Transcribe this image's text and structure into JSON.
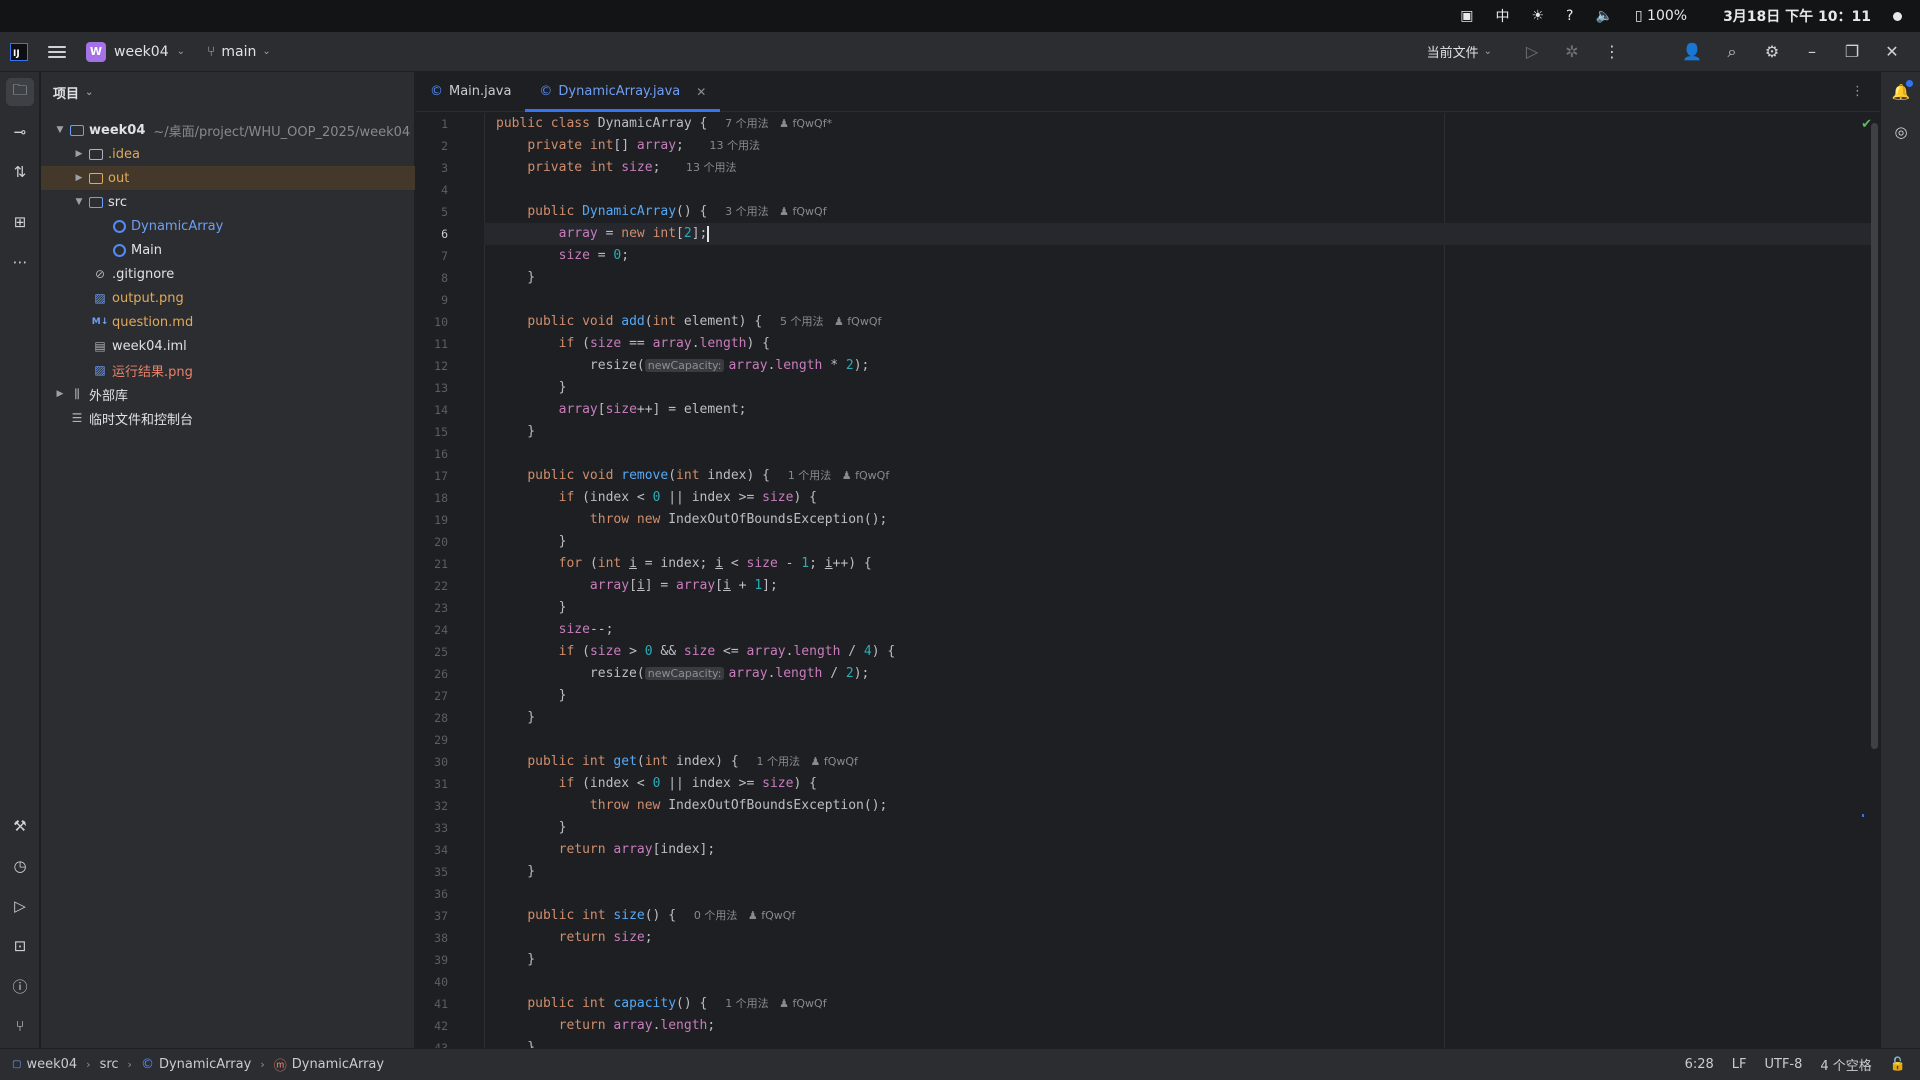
{
  "system_bar": {
    "input_method": "中",
    "battery": "100%",
    "clock": "3月18日 下午 10：11"
  },
  "title_bar": {
    "project_initial": "W",
    "project_name": "week04",
    "branch": "main",
    "run_config": "当前文件"
  },
  "project_panel": {
    "title": "项目",
    "tree": [
      {
        "name": "week04",
        "detail": "~/桌面/project/WHU_OOP_2025/week04",
        "depth": 0,
        "expanded": true,
        "kind": "module"
      },
      {
        "name": ".idea",
        "depth": 1,
        "expanded": false,
        "kind": "folder"
      },
      {
        "name": "out",
        "depth": 1,
        "expanded": false,
        "kind": "folder",
        "selected": true
      },
      {
        "name": "src",
        "depth": 1,
        "expanded": true,
        "kind": "folder"
      },
      {
        "name": "DynamicArray",
        "depth": 2,
        "kind": "class"
      },
      {
        "name": "Main",
        "depth": 2,
        "kind": "class-main"
      },
      {
        "name": ".gitignore",
        "depth": 1,
        "kind": "ignore"
      },
      {
        "name": "output.png",
        "depth": 1,
        "kind": "image"
      },
      {
        "name": "question.md",
        "depth": 1,
        "kind": "markdown"
      },
      {
        "name": "week04.iml",
        "depth": 1,
        "kind": "iml"
      },
      {
        "name": "运行结果.png",
        "depth": 1,
        "kind": "image"
      },
      {
        "name": "外部库",
        "depth": 0,
        "expanded": false,
        "kind": "library"
      },
      {
        "name": "临时文件和控制台",
        "depth": 0,
        "kind": "scratch"
      }
    ]
  },
  "editor": {
    "tabs": [
      {
        "label": "Main.java",
        "active": false
      },
      {
        "label": "DynamicArray.java",
        "active": true
      }
    ],
    "current_line": 6,
    "lines": [
      [
        [
          "kw",
          "public "
        ],
        [
          "kw",
          "class "
        ],
        [
          "t",
          "DynamicArray { "
        ],
        [
          "h",
          "7 个用法   ♟ fQwQf*"
        ]
      ],
      [
        [
          "t",
          "    "
        ],
        [
          "kw",
          "private "
        ],
        [
          "kw",
          "int"
        ],
        [
          "t",
          "[] "
        ],
        [
          "fld",
          "array"
        ],
        [
          "t",
          ";  "
        ],
        [
          "h",
          "13 个用法"
        ]
      ],
      [
        [
          "t",
          "    "
        ],
        [
          "kw",
          "private "
        ],
        [
          "kw",
          "int "
        ],
        [
          "fld",
          "size"
        ],
        [
          "t",
          ";  "
        ],
        [
          "h",
          "13 个用法"
        ]
      ],
      [],
      [
        [
          "t",
          "    "
        ],
        [
          "kw",
          "public "
        ],
        [
          "fn",
          "DynamicArray"
        ],
        [
          "t",
          "() { "
        ],
        [
          "h",
          "3 个用法   ♟ fQwQf"
        ]
      ],
      [
        [
          "t",
          "        "
        ],
        [
          "fld",
          "array"
        ],
        [
          "t",
          " = "
        ],
        [
          "kw",
          "new "
        ],
        [
          "kw",
          "int"
        ],
        [
          "t",
          "["
        ],
        [
          "num",
          "2"
        ],
        [
          "t",
          "];"
        ],
        [
          "caret",
          ""
        ]
      ],
      [
        [
          "t",
          "        "
        ],
        [
          "fld",
          "size"
        ],
        [
          "t",
          " = "
        ],
        [
          "num",
          "0"
        ],
        [
          "t",
          ";"
        ]
      ],
      [
        [
          "t",
          "    }"
        ]
      ],
      [],
      [
        [
          "t",
          "    "
        ],
        [
          "kw",
          "public "
        ],
        [
          "kw",
          "void "
        ],
        [
          "fn",
          "add"
        ],
        [
          "t",
          "("
        ],
        [
          "kw",
          "int "
        ],
        [
          "t",
          "element) { "
        ],
        [
          "h",
          "5 个用法   ♟ fQwQf"
        ]
      ],
      [
        [
          "t",
          "        "
        ],
        [
          "kw",
          "if "
        ],
        [
          "t",
          "("
        ],
        [
          "fld",
          "size"
        ],
        [
          "t",
          " == "
        ],
        [
          "fld",
          "array"
        ],
        [
          "t",
          "."
        ],
        [
          "fld",
          "length"
        ],
        [
          "t",
          ") {"
        ]
      ],
      [
        [
          "t",
          "            resize("
        ],
        [
          "inlay",
          "newCapacity:"
        ],
        [
          "fld",
          "array"
        ],
        [
          "t",
          "."
        ],
        [
          "fld",
          "length"
        ],
        [
          "t",
          " * "
        ],
        [
          "num",
          "2"
        ],
        [
          "t",
          ");"
        ]
      ],
      [
        [
          "t",
          "        }"
        ]
      ],
      [
        [
          "t",
          "        "
        ],
        [
          "fld",
          "array"
        ],
        [
          "t",
          "["
        ],
        [
          "fld",
          "size"
        ],
        [
          "t",
          "++] = element;"
        ]
      ],
      [
        [
          "t",
          "    }"
        ]
      ],
      [],
      [
        [
          "t",
          "    "
        ],
        [
          "kw",
          "public "
        ],
        [
          "kw",
          "void "
        ],
        [
          "fn",
          "remove"
        ],
        [
          "t",
          "("
        ],
        [
          "kw",
          "int "
        ],
        [
          "t",
          "index) { "
        ],
        [
          "h",
          "1 个用法   ♟ fQwQf"
        ]
      ],
      [
        [
          "t",
          "        "
        ],
        [
          "kw",
          "if "
        ],
        [
          "t",
          "(index < "
        ],
        [
          "num",
          "0"
        ],
        [
          "t",
          " || index >= "
        ],
        [
          "fld",
          "size"
        ],
        [
          "t",
          ") {"
        ]
      ],
      [
        [
          "t",
          "            "
        ],
        [
          "kw",
          "throw "
        ],
        [
          "kw",
          "new "
        ],
        [
          "t",
          "IndexOutOfBoundsException();"
        ]
      ],
      [
        [
          "t",
          "        }"
        ]
      ],
      [
        [
          "t",
          "        "
        ],
        [
          "kw",
          "for "
        ],
        [
          "t",
          "("
        ],
        [
          "kw",
          "int "
        ],
        [
          "u",
          "i"
        ],
        [
          "t",
          " = index; "
        ],
        [
          "u",
          "i"
        ],
        [
          "t",
          " < "
        ],
        [
          "fld",
          "size"
        ],
        [
          "t",
          " - "
        ],
        [
          "num",
          "1"
        ],
        [
          "t",
          "; "
        ],
        [
          "u",
          "i"
        ],
        [
          "t",
          "++) {"
        ]
      ],
      [
        [
          "t",
          "            "
        ],
        [
          "fld",
          "array"
        ],
        [
          "t",
          "["
        ],
        [
          "u",
          "i"
        ],
        [
          "t",
          "] = "
        ],
        [
          "fld",
          "array"
        ],
        [
          "t",
          "["
        ],
        [
          "u",
          "i"
        ],
        [
          "t",
          " + "
        ],
        [
          "num",
          "1"
        ],
        [
          "t",
          "];"
        ]
      ],
      [
        [
          "t",
          "        }"
        ]
      ],
      [
        [
          "t",
          "        "
        ],
        [
          "fld",
          "size"
        ],
        [
          "t",
          "--;"
        ]
      ],
      [
        [
          "t",
          "        "
        ],
        [
          "kw",
          "if "
        ],
        [
          "t",
          "("
        ],
        [
          "fld",
          "size"
        ],
        [
          "t",
          " > "
        ],
        [
          "num",
          "0"
        ],
        [
          "t",
          " && "
        ],
        [
          "fld",
          "size"
        ],
        [
          "t",
          " <= "
        ],
        [
          "fld",
          "array"
        ],
        [
          "t",
          "."
        ],
        [
          "fld",
          "length"
        ],
        [
          "t",
          " / "
        ],
        [
          "num",
          "4"
        ],
        [
          "t",
          ") {"
        ]
      ],
      [
        [
          "t",
          "            resize("
        ],
        [
          "inlay",
          "newCapacity:"
        ],
        [
          "fld",
          "array"
        ],
        [
          "t",
          "."
        ],
        [
          "fld",
          "length"
        ],
        [
          "t",
          " / "
        ],
        [
          "num",
          "2"
        ],
        [
          "t",
          ");"
        ]
      ],
      [
        [
          "t",
          "        }"
        ]
      ],
      [
        [
          "t",
          "    }"
        ]
      ],
      [],
      [
        [
          "t",
          "    "
        ],
        [
          "kw",
          "public "
        ],
        [
          "kw",
          "int "
        ],
        [
          "fn",
          "get"
        ],
        [
          "t",
          "("
        ],
        [
          "kw",
          "int "
        ],
        [
          "t",
          "index) { "
        ],
        [
          "h",
          "1 个用法   ♟ fQwQf"
        ]
      ],
      [
        [
          "t",
          "        "
        ],
        [
          "kw",
          "if "
        ],
        [
          "t",
          "(index < "
        ],
        [
          "num",
          "0"
        ],
        [
          "t",
          " || index >= "
        ],
        [
          "fld",
          "size"
        ],
        [
          "t",
          ") {"
        ]
      ],
      [
        [
          "t",
          "            "
        ],
        [
          "kw",
          "throw "
        ],
        [
          "kw",
          "new "
        ],
        [
          "t",
          "IndexOutOfBoundsException();"
        ]
      ],
      [
        [
          "t",
          "        }"
        ]
      ],
      [
        [
          "t",
          "        "
        ],
        [
          "kw",
          "return "
        ],
        [
          "fld",
          "array"
        ],
        [
          "t",
          "[index];"
        ]
      ],
      [
        [
          "t",
          "    }"
        ]
      ],
      [],
      [
        [
          "t",
          "    "
        ],
        [
          "kw",
          "public "
        ],
        [
          "kw",
          "int "
        ],
        [
          "fn",
          "size"
        ],
        [
          "t",
          "() { "
        ],
        [
          "h",
          "0 个用法   ♟ fQwQf"
        ]
      ],
      [
        [
          "t",
          "        "
        ],
        [
          "kw",
          "return "
        ],
        [
          "fld",
          "size"
        ],
        [
          "t",
          ";"
        ]
      ],
      [
        [
          "t",
          "    }"
        ]
      ],
      [],
      [
        [
          "t",
          "    "
        ],
        [
          "kw",
          "public "
        ],
        [
          "kw",
          "int "
        ],
        [
          "fn",
          "capacity"
        ],
        [
          "t",
          "() { "
        ],
        [
          "h",
          "1 个用法   ♟ fQwQf"
        ]
      ],
      [
        [
          "t",
          "        "
        ],
        [
          "kw",
          "return "
        ],
        [
          "fld",
          "array"
        ],
        [
          "t",
          "."
        ],
        [
          "fld",
          "length"
        ],
        [
          "t",
          ";"
        ]
      ],
      [
        [
          "t",
          "    }"
        ]
      ]
    ]
  },
  "status_bar": {
    "breadcrumbs": [
      "week04",
      "src",
      "DynamicArray",
      "DynamicArray"
    ],
    "position": "6:28",
    "line_separator": "LF",
    "encoding": "UTF-8",
    "indent": "4 个空格"
  },
  "colors": {
    "accent": "#3574f0",
    "keyword": "#cf8e6d",
    "function": "#56a8f5",
    "field": "#c77dbb",
    "number": "#2aacb8",
    "project_badge": "#a571e6"
  }
}
